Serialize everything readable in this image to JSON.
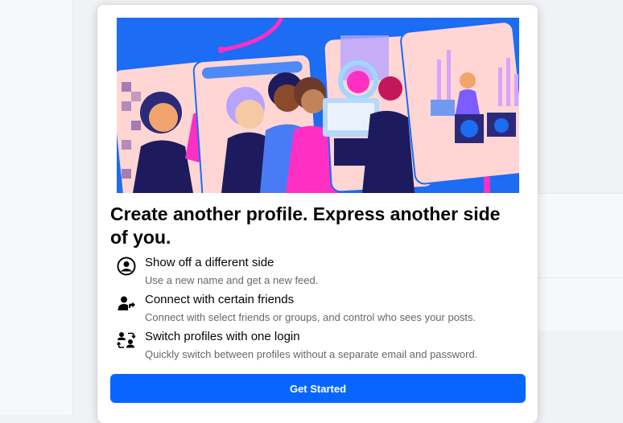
{
  "modal": {
    "title": "Create another profile. Express another side of you.",
    "features": [
      {
        "icon": "profile-circle-icon",
        "title": "Show off a different side",
        "description": "Use a new name and get a new feed."
      },
      {
        "icon": "person-share-icon",
        "title": "Connect with certain friends",
        "description": "Connect with select friends or groups, and control who sees your posts."
      },
      {
        "icon": "switch-profiles-icon",
        "title": "Switch profiles with one login",
        "description": "Quickly switch between profiles without a separate email and password."
      }
    ],
    "cta_label": "Get Started"
  },
  "colors": {
    "accent": "#0866ff",
    "hero_background": "#1c6cf4",
    "hero_pink": "#ff2fc4",
    "hero_card": "#ffd6d3"
  }
}
